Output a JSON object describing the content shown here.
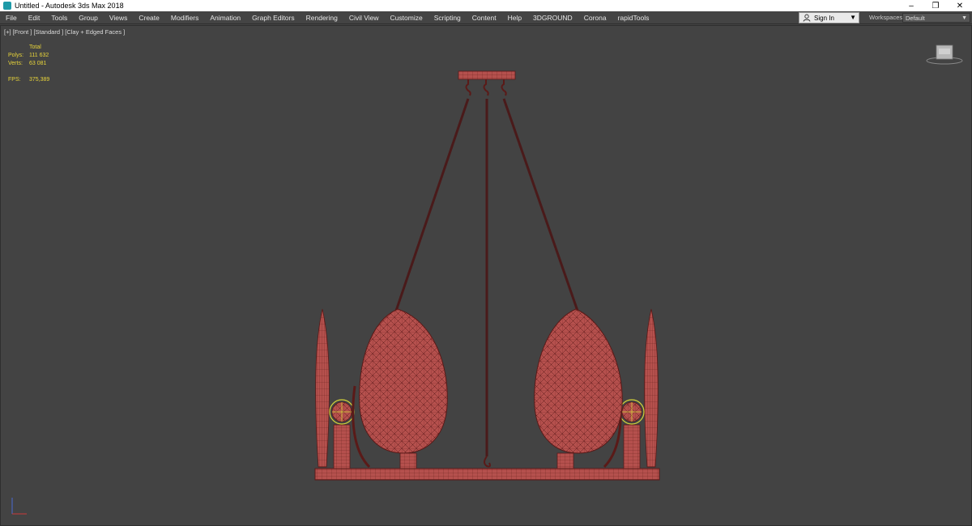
{
  "window": {
    "title": "Untitled - Autodesk 3ds Max 2018",
    "controls": {
      "minimize": "–",
      "restore": "❐",
      "close": "✕"
    }
  },
  "menu": {
    "items": [
      "File",
      "Edit",
      "Tools",
      "Group",
      "Views",
      "Create",
      "Modifiers",
      "Animation",
      "Graph Editors",
      "Rendering",
      "Civil View",
      "Customize",
      "Scripting",
      "Content",
      "Help",
      "3DGROUND",
      "Corona",
      "rapidTools"
    ]
  },
  "signin": {
    "label": "Sign In"
  },
  "workspaces": {
    "label": "Workspaces:",
    "value": "Default"
  },
  "viewport": {
    "label": "[+] [Front ] [Standard ] [Clay + Edged Faces ]",
    "stats": {
      "header": "Total",
      "polys_label": "Polys:",
      "polys_value": "111 632",
      "verts_label": "Verts:",
      "verts_value": "63 081",
      "fps_label": "FPS:",
      "fps_value": "375,389"
    }
  },
  "colors": {
    "model": "#b5504d",
    "wire": "#5a1a18",
    "stats": "#e8d43a",
    "viewport_bg": "#434343"
  },
  "icons": [
    "app-icon",
    "user-icon",
    "viewcube-icon",
    "axis-gizmo-icon"
  ]
}
